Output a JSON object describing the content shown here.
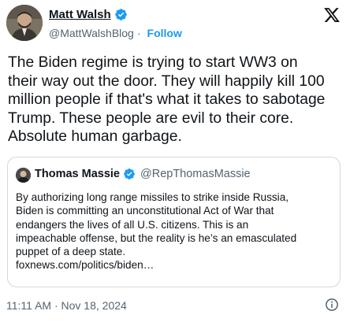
{
  "author": {
    "name": "Matt Walsh",
    "handle": "@MattWalshBlog",
    "separator": "·",
    "follow_label": "Follow"
  },
  "tweet": {
    "text": "The Biden regime is trying to start WW3 on\ntheir way out the door. They will happily kill 100\nmillion people if that's what it takes to sabotage\nTrump. These people are evil to their core.\nAbsolute human garbage."
  },
  "quoted": {
    "name": "Thomas Massie",
    "handle": "@RepThomasMassie",
    "text": "By authorizing long range missiles to strike inside Russia,\nBiden is committing  an unconstitutional Act of War that\nendangers the lives of all U.S. citizens. This is an\nimpeachable offense, but the reality is he’s an emasculated\npuppet of a deep state.\n foxnews.com/politics/biden…"
  },
  "footer": {
    "timestamp": "11:11 AM · Nov 18, 2024"
  },
  "icons": {
    "verified": "verified-badge-icon",
    "x_logo": "x-logo-icon",
    "info": "info-icon"
  },
  "colors": {
    "accent": "#1d9bf0",
    "text": "#0f1419",
    "secondary": "#536471",
    "border": "#cfd9de"
  }
}
